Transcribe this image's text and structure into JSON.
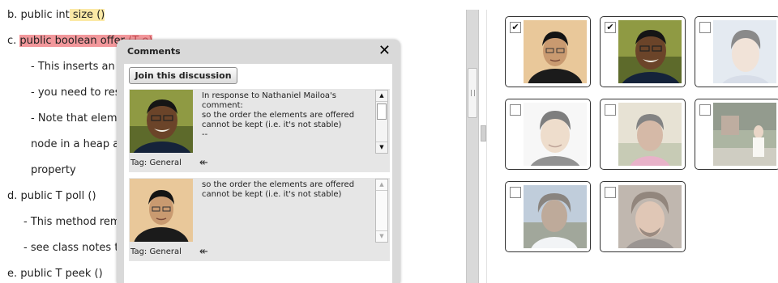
{
  "document": {
    "lines": [
      {
        "prefix": "b. public int",
        "highlight": " size ()",
        "color": "#fbe9a6"
      },
      {
        "prefix": "c. ",
        "highlight": "public boolean offer",
        "faded": " (T e)",
        "color": "#f2979b"
      },
      {
        "text": "- This inserts an el"
      },
      {
        "text": "- you need to resiz"
      },
      {
        "text": "- Note that elemer"
      },
      {
        "text": "node in a heap a"
      },
      {
        "text": "property"
      },
      {
        "text": "d. public T poll ()"
      },
      {
        "text": "- This method rem"
      },
      {
        "text": "- see class notes t"
      },
      {
        "text": "e. public T peek ()"
      }
    ]
  },
  "comments_popup": {
    "title": "Comments",
    "close_symbol": "✕",
    "join_label": "Join this discussion",
    "reply_icon": "reply-all-icon",
    "comments": [
      {
        "text": "In response to Nathaniel Mailoa's comment:\nso the order the elements are offered cannot be kept (i.e. it's not stable)\n--",
        "tag": "Tag: General",
        "avatar": "smiling-man-glasses"
      },
      {
        "text": "so the order the elements are offered cannot be kept (i.e. it's not stable)",
        "tag": "Tag: General",
        "avatar": "young-man-glasses"
      }
    ]
  },
  "gallery": {
    "tiles": [
      {
        "checked": true,
        "check_mark": "✔",
        "photo": "young-man-glasses"
      },
      {
        "checked": true,
        "check_mark": "✔",
        "photo": "smiling-man-glasses"
      },
      {
        "checked": false,
        "photo": "young-man-portrait"
      },
      {
        "checked": false,
        "photo": "smiling-young-man"
      },
      {
        "checked": false,
        "photo": "smiling-man-outdoors"
      },
      {
        "checked": false,
        "photo": "woman-outdoors"
      },
      {
        "checked": false,
        "photo": "man-outdoors-curly-hair"
      },
      {
        "checked": false,
        "photo": "bearded-man-curly-hair"
      }
    ]
  },
  "colors": {
    "highlight_yellow": "#fbe9a6",
    "highlight_red": "#f2979b",
    "popup_frame": "#d9d9d9",
    "comment_bg": "#e6e6e6"
  }
}
